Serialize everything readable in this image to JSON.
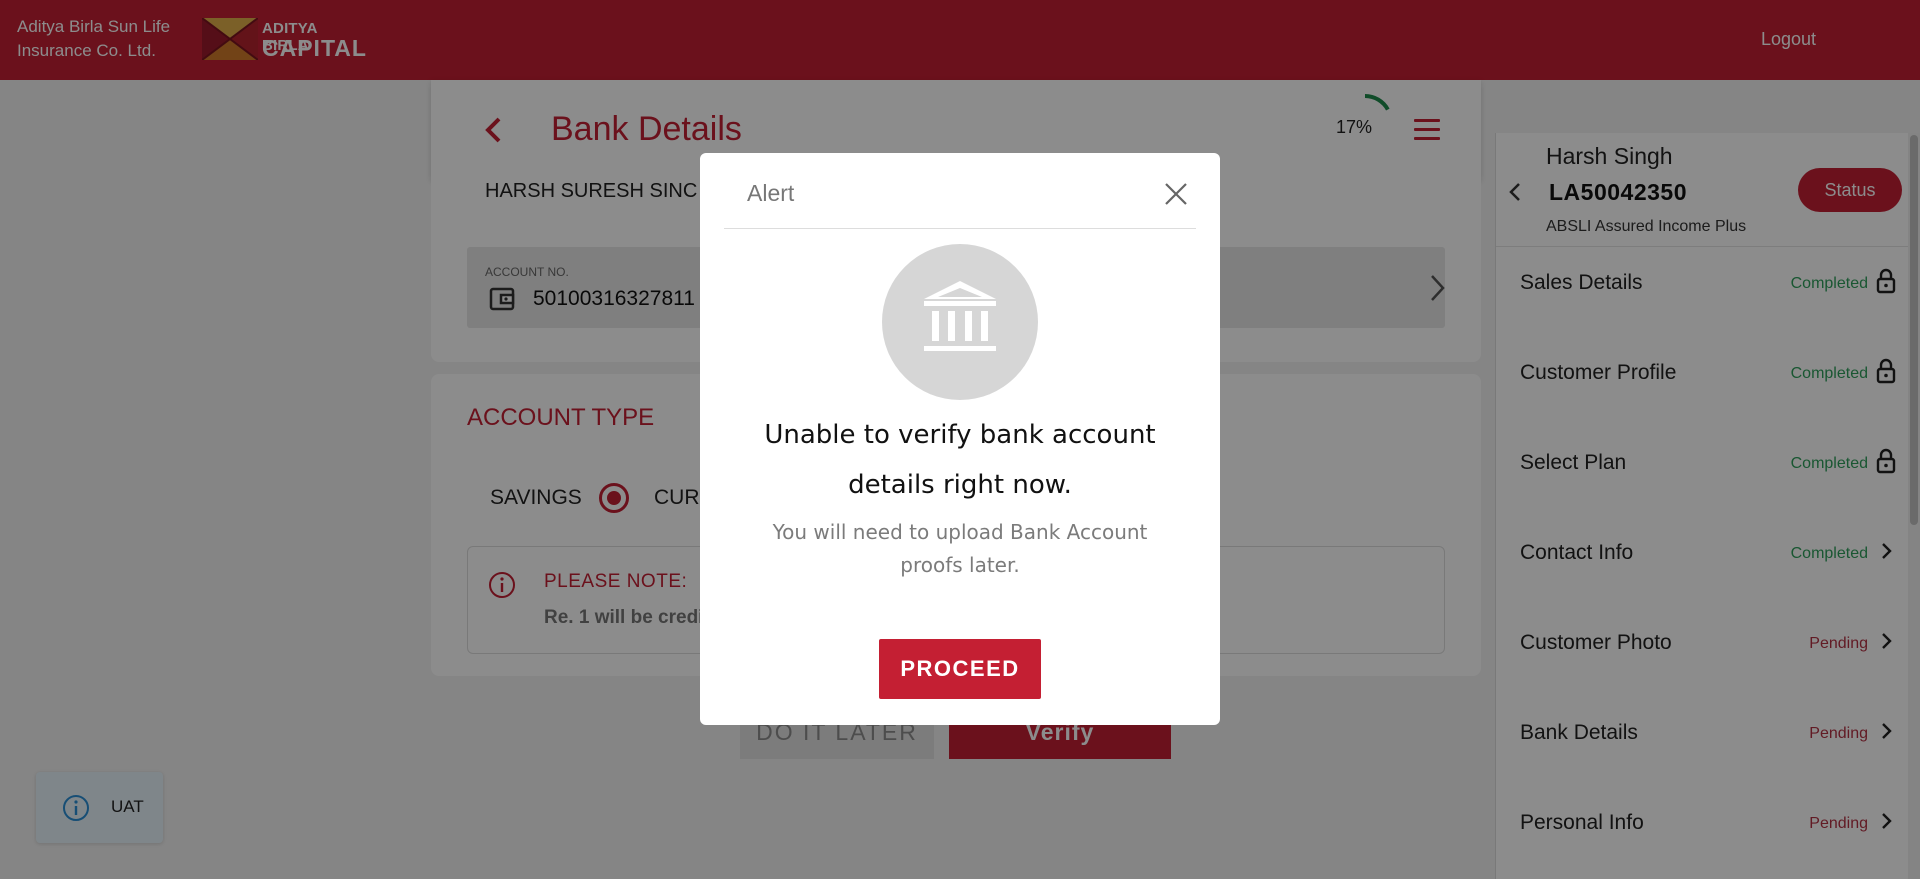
{
  "header": {
    "brand_line1": "Aditya Birla Sun Life",
    "brand_line2": "Insurance Co. Ltd.",
    "logo_line1": "ADITYA BIRLA",
    "logo_line2": "CAPITAL",
    "logout_label": "Logout"
  },
  "page": {
    "title": "Bank Details",
    "progress_percent": 17,
    "progress_text": "17%",
    "account_holder": "HARSH SURESH SINC",
    "account_no_label": "ACCOUNT NO.",
    "account_no_value": "50100316327811",
    "account_type_title": "ACCOUNT TYPE",
    "savings_label": "SAVINGS",
    "current_label": "CUR",
    "note_title": "PLEASE NOTE:",
    "note_text": "Re. 1 will be credi",
    "do_it_later_label": "DO IT LATER",
    "verify_label": "Verify"
  },
  "sidebar": {
    "name": "Harsh Singh",
    "application_no": "LA50042350",
    "plan": "ABSLI Assured Income Plus",
    "status_button": "Status",
    "items": [
      {
        "label": "Sales Details",
        "status": "Completed",
        "icon": "lock-icon"
      },
      {
        "label": "Customer Profile",
        "status": "Completed",
        "icon": "lock-icon"
      },
      {
        "label": "Select Plan",
        "status": "Completed",
        "icon": "lock-icon"
      },
      {
        "label": "Contact Info",
        "status": "Completed",
        "icon": "chevron-right-icon"
      },
      {
        "label": "Customer Photo",
        "status": "Pending",
        "icon": "chevron-right-icon"
      },
      {
        "label": "Bank Details",
        "status": "Pending",
        "icon": "chevron-right-icon"
      },
      {
        "label": "Personal Info",
        "status": "Pending",
        "icon": "chevron-right-icon"
      }
    ]
  },
  "env_badge": {
    "label": "UAT",
    "icon": "info-icon"
  },
  "modal": {
    "title": "Alert",
    "icon": "bank-icon",
    "heading": "Unable to verify bank account details right now.",
    "message": "You will need to upload Bank Account proofs later.",
    "proceed_label": "PROCEED"
  },
  "colors": {
    "brand": "#c41f33",
    "completed": "#2e9e5b",
    "pending": "#b23244",
    "progress": "#1e8a4c"
  }
}
